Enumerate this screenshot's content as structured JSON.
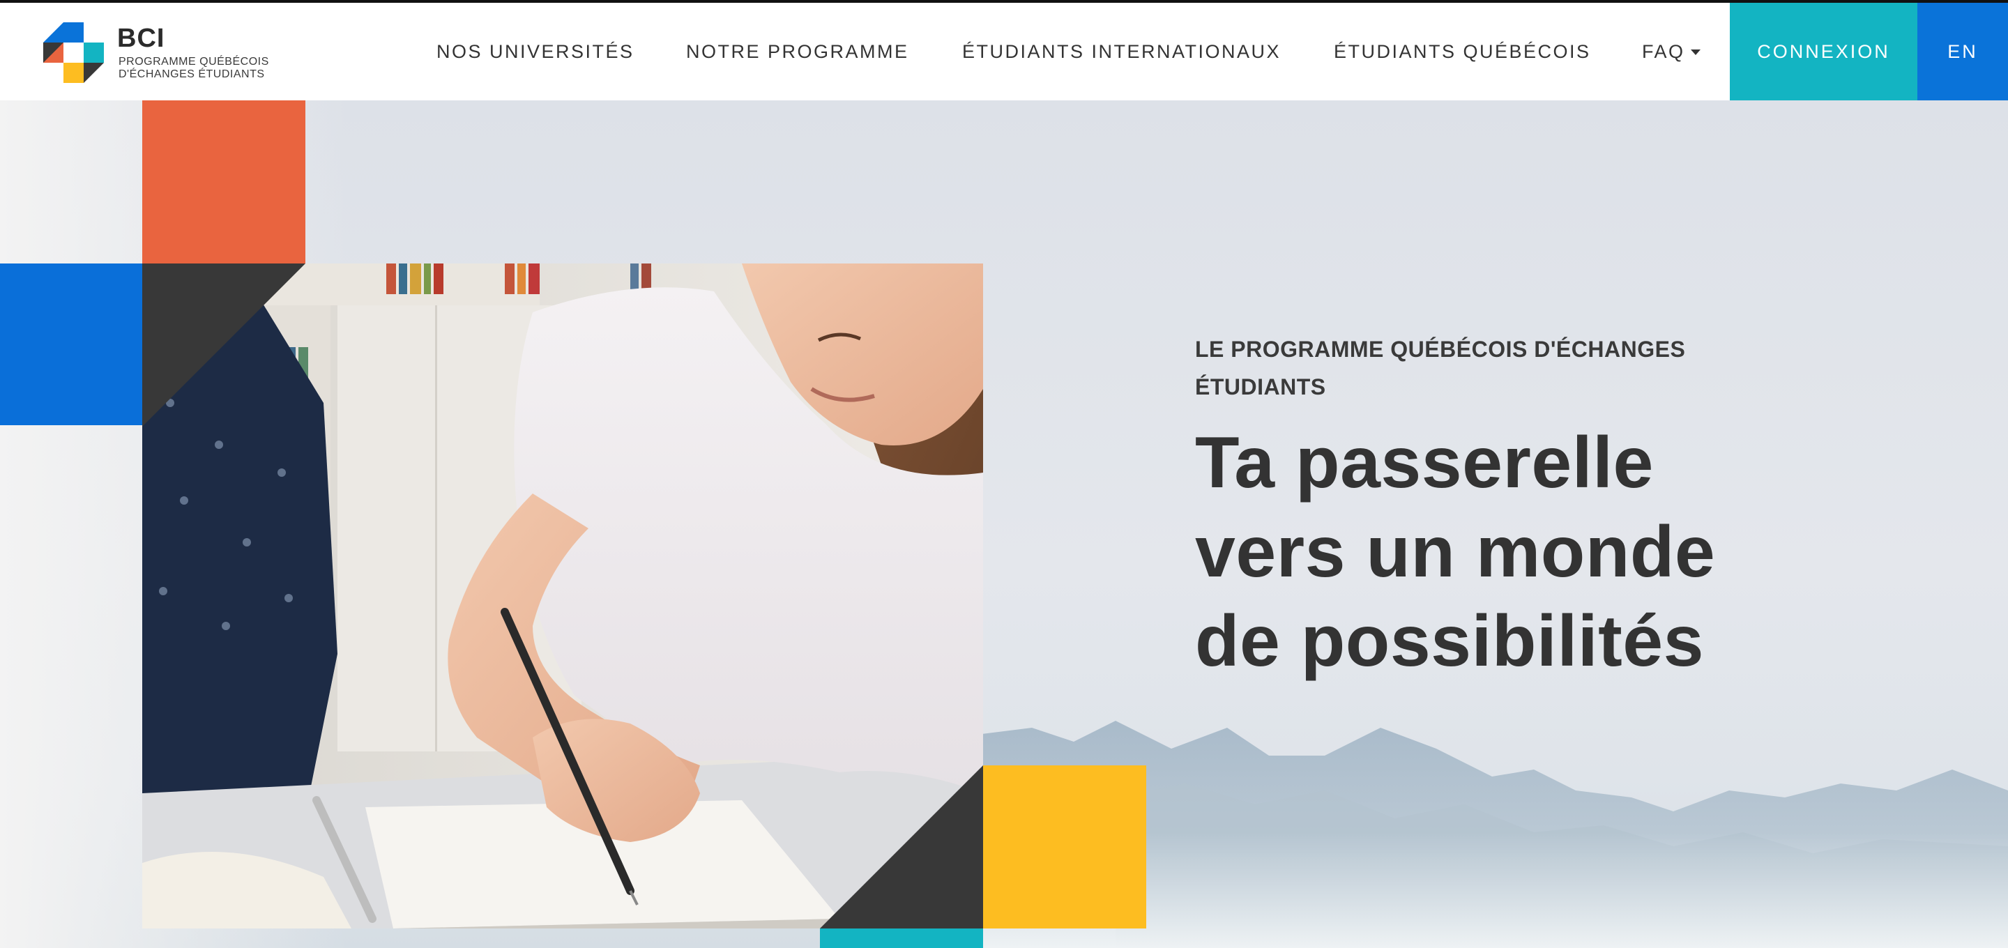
{
  "brand": {
    "title": "BCI",
    "subtitle_line1": "PROGRAMME QUÉBÉCOIS",
    "subtitle_line2": "D'ÉCHANGES ÉTUDIANTS"
  },
  "nav": {
    "items": [
      {
        "label": "NOS UNIVERSITÉS"
      },
      {
        "label": "NOTRE PROGRAMME"
      },
      {
        "label": "ÉTUDIANTS INTERNATIONAUX"
      },
      {
        "label": "ÉTUDIANTS QUÉBÉCOIS"
      },
      {
        "label": "FAQ",
        "icon": "caret-down-icon"
      }
    ],
    "login_label": "CONNEXION",
    "language_label": "EN"
  },
  "hero": {
    "eyebrow_line1": "LE PROGRAMME QUÉBÉCOIS D'ÉCHANGES",
    "eyebrow_line2": "ÉTUDIANTS",
    "headline_line1": "Ta passerelle",
    "headline_line2": "vers un monde",
    "headline_line3": "de possibilités"
  },
  "colors": {
    "teal": "#13b4c2",
    "blue": "#0a73d9",
    "orange": "#e9643f",
    "yellow": "#fdbd21",
    "dark": "#383838"
  }
}
